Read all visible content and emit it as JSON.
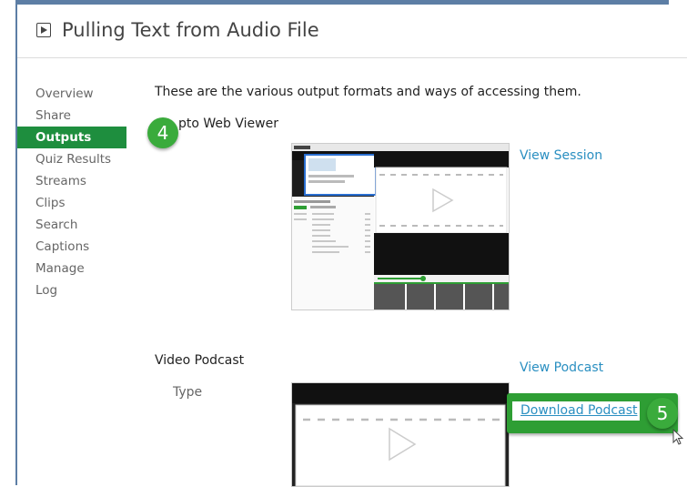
{
  "title": "Pulling Text from Audio File",
  "nav": {
    "items": [
      {
        "label": "Overview"
      },
      {
        "label": "Share"
      },
      {
        "label": "Outputs"
      },
      {
        "label": "Quiz Results"
      },
      {
        "label": "Streams"
      },
      {
        "label": "Clips"
      },
      {
        "label": "Search"
      },
      {
        "label": "Captions"
      },
      {
        "label": "Manage"
      },
      {
        "label": "Log"
      }
    ],
    "active": "Outputs"
  },
  "content": {
    "intro": "These are the various output formats and ways of accessing them.",
    "viewer": {
      "label_partial": "pto Web Viewer",
      "link": "View Session"
    },
    "podcast": {
      "label": "Video Podcast",
      "type_label": "Type",
      "view_link": "View Podcast",
      "download_link": "Download Podcast"
    }
  },
  "callouts": {
    "step4": "4",
    "step5": "5"
  },
  "colors": {
    "accent_green": "#1e8e3e",
    "callout_green": "#3aab3c",
    "link_blue": "#2a8fc1",
    "frame_blue": "#5d7ea5"
  }
}
